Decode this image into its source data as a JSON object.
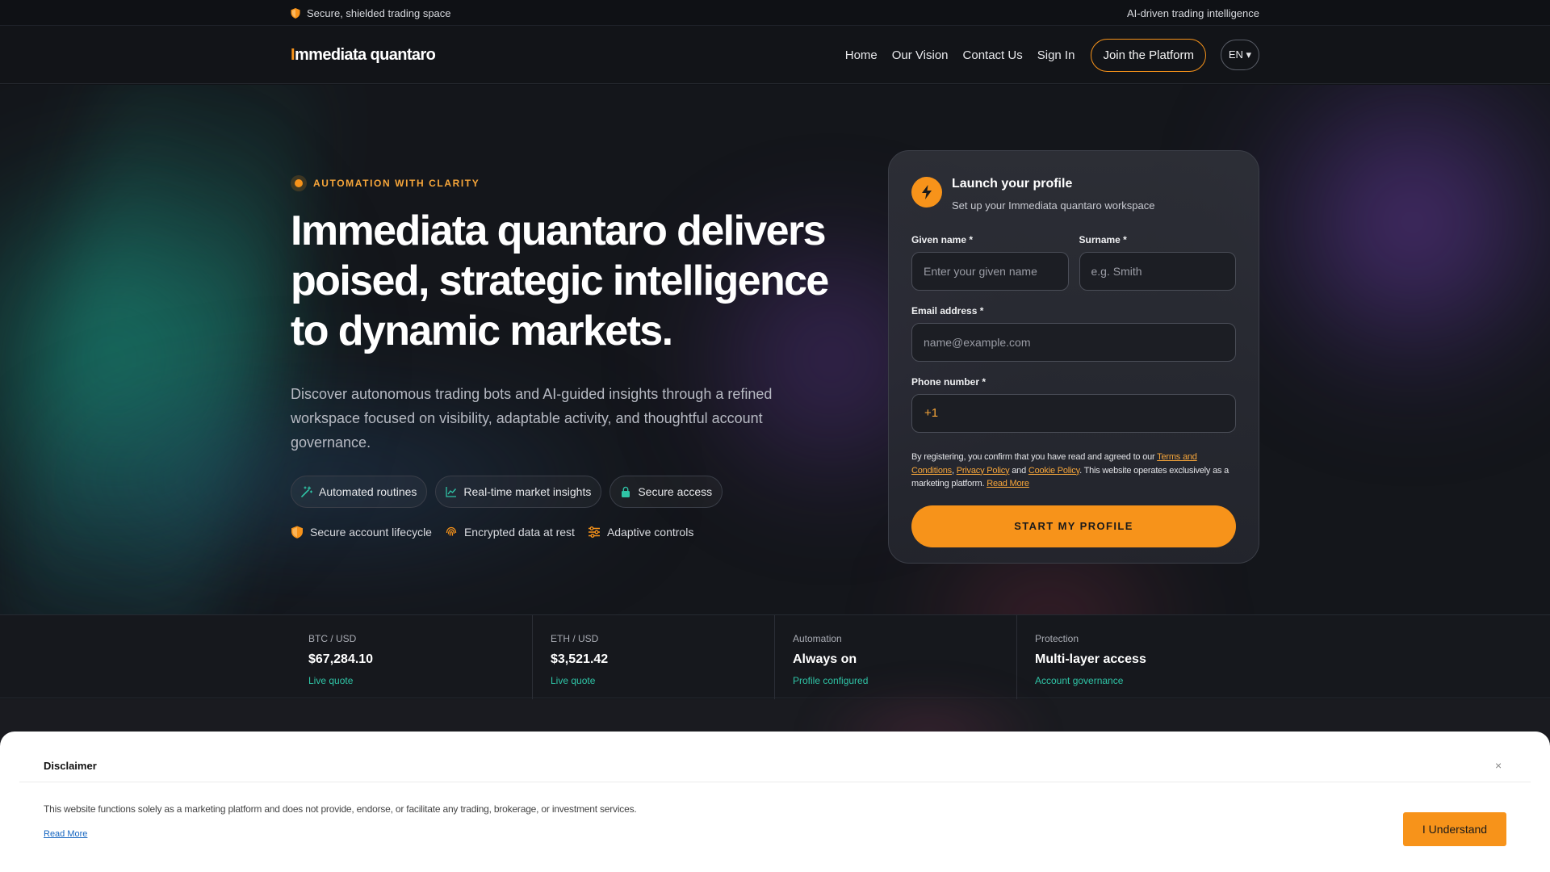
{
  "topstrip": {
    "left_text": "Secure, shielded trading space",
    "right_text": "AI-driven trading intelligence",
    "left_icon": "shield-icon"
  },
  "nav": {
    "brand_first": "I",
    "brand_rest": "mmediata quantaro",
    "links": [
      "Home",
      "Our Vision",
      "Contact Us",
      "Sign In"
    ],
    "join_label": "Join the Platform",
    "lang_label": "EN ▾"
  },
  "hero": {
    "eyebrow": "AUTOMATION WITH CLARITY",
    "headline": "Immediata quantaro delivers poised, strategic intelligence to dynamic markets.",
    "subtext": "Discover autonomous trading bots and AI-guided insights through a refined workspace focused on visibility, adaptable activity, and thoughtful account governance.",
    "chips": [
      {
        "label": "Automated routines",
        "icon": "magic-wand-icon"
      },
      {
        "label": "Real-time market insights",
        "icon": "line-chart-icon"
      },
      {
        "label": "Secure access",
        "icon": "lock-icon"
      }
    ],
    "badges": [
      {
        "label": "Secure account lifecycle",
        "icon": "shield-icon"
      },
      {
        "label": "Encrypted data at rest",
        "icon": "fingerprint-icon"
      },
      {
        "label": "Adaptive controls",
        "icon": "sliders-icon"
      }
    ],
    "colors": {
      "accent": "#f7931a",
      "teal": "#2fc4a6"
    }
  },
  "form": {
    "title": "Launch your profile",
    "subtitle": "Set up your Immediata quantaro workspace",
    "given_label": "Given name *",
    "given_placeholder": "Enter your given name",
    "surname_label": "Surname *",
    "surname_placeholder": "e.g. Smith",
    "email_label": "Email address *",
    "email_placeholder": "name@example.com",
    "phone_label": "Phone number *",
    "phone_code": "+1",
    "legal_prefix": "By registering, you confirm that you have read and agreed to our ",
    "terms": "Terms and Conditions",
    "sep1": ", ",
    "privacy": "Privacy Policy",
    "sep2": " and ",
    "cookie": "Cookie Policy",
    "legal_mid": ". This website operates exclusively as a marketing platform. ",
    "read_more": "Read More",
    "cta": "START MY PROFILE"
  },
  "ticker": [
    {
      "label": "BTC / USD",
      "value": "$67,284.10",
      "note": "Live quote"
    },
    {
      "label": "ETH / USD",
      "value": "$3,521.42",
      "note": "Live quote"
    },
    {
      "label": "Automation",
      "value": "Always on",
      "note": "Profile configured"
    },
    {
      "label": "Protection",
      "value": "Multi-layer access",
      "note": "Account governance"
    }
  ],
  "disclaimer": {
    "title": "Disclaimer",
    "close": "×",
    "text": "This website functions solely as a marketing platform and does not provide, endorse, or facilitate any trading, brokerage, or investment services.",
    "read_more": "Read More",
    "button": "I Understand"
  }
}
